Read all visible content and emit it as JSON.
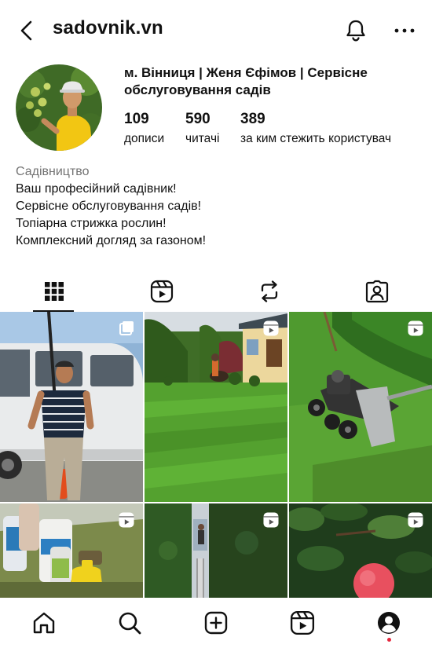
{
  "header": {
    "username": "sadovnik.vn",
    "back_icon": "chevron-left-icon",
    "bell_icon": "bell-icon",
    "more_icon": "more-horizontal-icon"
  },
  "profile": {
    "name": "м. Вінниця | Женя Єфімов | Сервісне обслуговування садів",
    "stats": [
      {
        "count": "109",
        "label": "дописи"
      },
      {
        "count": "590",
        "label": "читачі"
      },
      {
        "count": "389",
        "label": "за ким стежить користувач"
      }
    ],
    "bio": {
      "category": "Садівництво",
      "lines": [
        "Ваш професійний садівник!",
        "Сервісне обслуговування садів!",
        "Топіарна стрижка рослин!",
        "Комплексний догляд за газоном!"
      ]
    }
  },
  "tabs": [
    {
      "name": "posts",
      "icon": "grid-icon",
      "active": true
    },
    {
      "name": "reels",
      "icon": "reels-icon",
      "active": false
    },
    {
      "name": "reposts",
      "icon": "repost-icon",
      "active": false
    },
    {
      "name": "tagged",
      "icon": "tagged-user-icon",
      "active": false
    }
  ],
  "grid": [
    {
      "name": "post-man-van",
      "badge": "carousel-icon"
    },
    {
      "name": "post-lawn-house",
      "badge": "reels-icon"
    },
    {
      "name": "post-lawn-aerator",
      "badge": "reels-icon"
    },
    {
      "name": "post-garden-chemicals",
      "badge": "reels-icon"
    },
    {
      "name": "post-hedge-trimming",
      "badge": "reels-icon"
    },
    {
      "name": "post-apple-tree",
      "badge": "reels-icon"
    }
  ],
  "bottom_nav": [
    {
      "name": "home",
      "icon": "home-icon"
    },
    {
      "name": "search",
      "icon": "search-icon"
    },
    {
      "name": "create",
      "icon": "add-square-icon"
    },
    {
      "name": "reels",
      "icon": "reels-icon"
    },
    {
      "name": "profile",
      "icon": "profile-icon"
    }
  ],
  "colors": {
    "notification_dot": "#e5283d",
    "secondary_text": "#737373",
    "primary_text": "#111111"
  }
}
